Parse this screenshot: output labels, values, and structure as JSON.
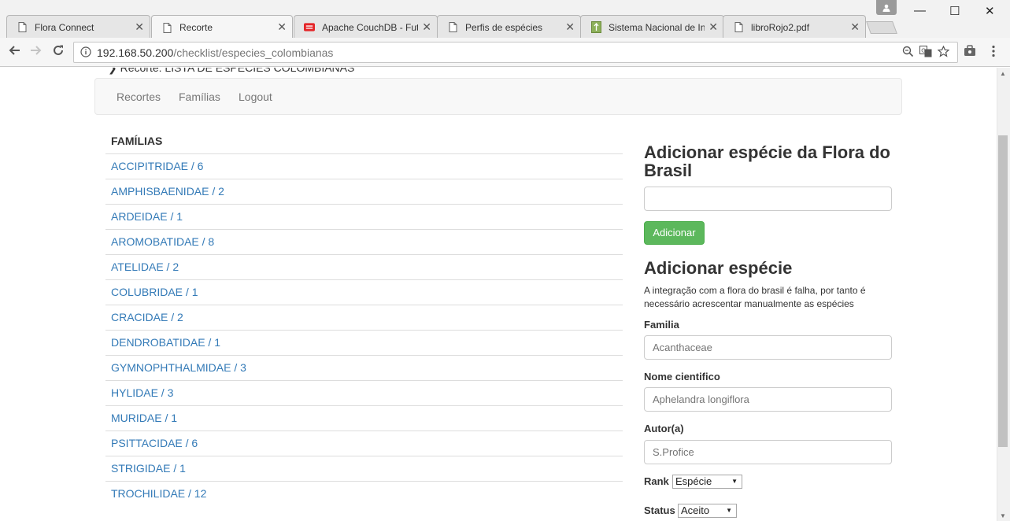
{
  "browser": {
    "tabs": [
      {
        "title": "Flora Connect",
        "icon": "page-icon",
        "active": false
      },
      {
        "title": "Recorte",
        "icon": "page-icon",
        "active": true
      },
      {
        "title": "Apache CouchDB - Fut",
        "icon": "couchdb-icon",
        "active": false
      },
      {
        "title": "Perfis de espécies",
        "icon": "page-icon",
        "active": false
      },
      {
        "title": "Sistema Nacional de In",
        "icon": "sinia-icon",
        "active": false
      },
      {
        "title": "libroRojo2.pdf",
        "icon": "page-icon",
        "active": false
      }
    ],
    "url_host": "192.168.50.200",
    "url_path": "/checklist/especies_colombianas",
    "window_controls": {
      "minimize": "—",
      "maximize": "☐",
      "close": "✕"
    }
  },
  "page": {
    "cut_text": "❯ Recorte: LISTA DE ESPÉCIES COLOMBIANAS",
    "nav": [
      "Recortes",
      "Famílias",
      "Logout"
    ],
    "families_header": "FAMÍLIAS",
    "families": [
      "ACCIPITRIDAE / 6",
      "AMPHISBAENIDAE / 2",
      "ARDEIDAE / 1",
      "AROMOBATIDAE / 8",
      "ATELIDAE / 2",
      "COLUBRIDAE / 1",
      "CRACIDAE / 2",
      "DENDROBATIDAE / 1",
      "GYMNOPHTHALMIDAE / 3",
      "HYLIDAE / 3",
      "MURIDAE / 1",
      "PSITTACIDAE / 6",
      "STRIGIDAE / 1",
      "TROCHILIDAE / 12"
    ],
    "flora_form": {
      "title": "Adicionar espécie da Flora do Brasil",
      "input_value": "",
      "button": "Adicionar"
    },
    "manual_form": {
      "title": "Adicionar espécie",
      "help": "A integração com a flora do brasil é falha, por tanto é necessário acrescentar manualmente as espécies",
      "familia_label": "Familia",
      "familia_placeholder": "Acanthaceae",
      "nome_label": "Nome cientifico",
      "nome_placeholder": "Aphelandra longiflora",
      "autor_label": "Autor(a)",
      "autor_placeholder": "S.Profice",
      "rank_label": "Rank",
      "rank_value": "Espécie",
      "status_label": "Status",
      "status_value": "Aceito"
    }
  },
  "colors": {
    "link": "#337ab7",
    "success": "#5cb85c",
    "navbar_bg": "#f8f8f8"
  }
}
